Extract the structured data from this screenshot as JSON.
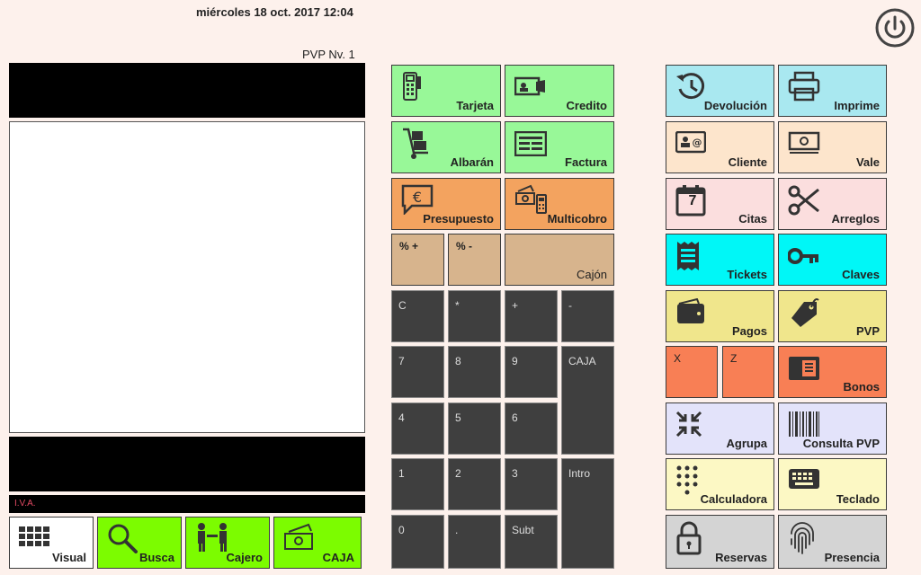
{
  "header": {
    "datetime": "miércoles 18 oct. 2017 12:04",
    "pvp_level": "PVP Nv. 1"
  },
  "iva_label": "I.V.A.",
  "bottom_buttons": {
    "visual": "Visual",
    "busca": "Busca",
    "cajero": "Cajero",
    "caja": "CAJA"
  },
  "middle_buttons": {
    "tarjeta": "Tarjeta",
    "credito": "Credito",
    "albaran": "Albarán",
    "factura": "Factura",
    "presupuesto": "Presupuesto",
    "multicobro": "Multicobro",
    "pct_plus": "% +",
    "pct_minus": "% -",
    "cajon": "Cajón"
  },
  "keypad": {
    "c": "C",
    "mult": "*",
    "plus": "+",
    "minus": "-",
    "k7": "7",
    "k8": "8",
    "k9": "9",
    "caja": "CAJA",
    "k4": "4",
    "k5": "5",
    "k6": "6",
    "k1": "1",
    "k2": "2",
    "k3": "3",
    "intro": "Intro",
    "k0": "0",
    "dot": ".",
    "subt": "Subt"
  },
  "right_buttons": {
    "devolucion": "Devolución",
    "imprime": "Imprime",
    "cliente": "Cliente",
    "vale": "Vale",
    "citas": "Citas",
    "citas_day": "7",
    "arreglos": "Arreglos",
    "tickets": "Tickets",
    "claves": "Claves",
    "pagos": "Pagos",
    "pvp": "PVP",
    "x": "X",
    "z": "Z",
    "bonos": "Bonos",
    "agrupa": "Agrupa",
    "consulta_pvp": "Consulta PVP",
    "calculadora": "Calculadora",
    "teclado": "Teclado",
    "reservas": "Reservas",
    "presencia": "Presencia"
  }
}
